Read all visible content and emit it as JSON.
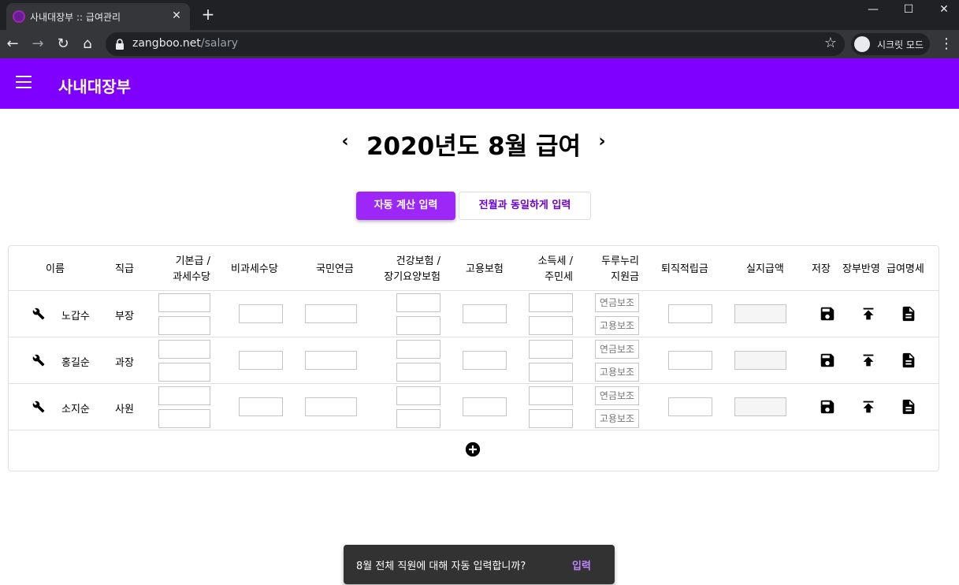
{
  "browser": {
    "tab_title": "사내대장부 :: 급여관리",
    "url_domain": "zangboo.net",
    "url_path": "/salary",
    "incognito_label": "시크릿 모드"
  },
  "app": {
    "title": "사내대장부",
    "accent": "#8000ff"
  },
  "month_title": "2020년도 8월 급여",
  "buttons": {
    "auto": "자동 계산 입력",
    "same": "전월과 동일하게 입력"
  },
  "columns": {
    "name": "이름",
    "rank": "직급",
    "base": "기본급 /",
    "base2": "과세수당",
    "nontax": "비과세수당",
    "pension": "국민연금",
    "health": "건강보험 /",
    "health2": "장기요양보험",
    "employ": "고용보험",
    "income": "소득세 /",
    "income2": "주민세",
    "durunuri": "두루누리",
    "durunuri2": "지원금",
    "severance": "퇴직적립금",
    "net": "실지급액",
    "save": "저장",
    "ledger": "장부반영",
    "payslip": "급여명세"
  },
  "placeholders": {
    "pension_support": "연금보조",
    "employ_support": "고용보조"
  },
  "employees": [
    {
      "name": "노갑수",
      "rank": "부장"
    },
    {
      "name": "홍길순",
      "rank": "과장"
    },
    {
      "name": "소지순",
      "rank": "사원"
    }
  ],
  "snackbar": {
    "message": "8월 전체 직원에 대해 자동 입력합니까?",
    "action": "입력"
  }
}
